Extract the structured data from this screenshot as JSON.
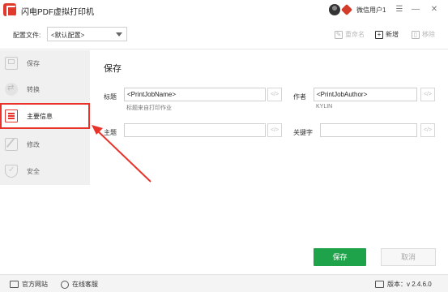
{
  "app": {
    "title": "闪电PDF虚拟打印机",
    "user_name": "微信用户1"
  },
  "toolbar": {
    "config_label": "配置文件:",
    "config_value": "<默认配置>",
    "rename_label": "重命名",
    "add_label": "新增",
    "remove_label": "移除"
  },
  "sidebar": {
    "items": [
      {
        "label": "保存",
        "icon": "save-icon",
        "active": false
      },
      {
        "label": "转换",
        "icon": "convert-icon",
        "active": false
      },
      {
        "label": "主要信息",
        "icon": "info-list-icon",
        "active": true
      },
      {
        "label": "修改",
        "icon": "edit-icon",
        "active": false
      },
      {
        "label": "安全",
        "icon": "shield-icon",
        "active": false
      }
    ]
  },
  "main": {
    "title": "保存",
    "fields": {
      "title": {
        "label": "标题",
        "value": "<PrintJobName>",
        "hint": "标题来自打印作业"
      },
      "author": {
        "label": "作者",
        "value": "<PrintJobAuthor>",
        "hint": "KYLIN"
      },
      "subject": {
        "label": "主题",
        "value": ""
      },
      "keywords": {
        "label": "关键字",
        "value": ""
      }
    },
    "code_button": "</>",
    "save_button": "保存",
    "cancel_button": "取消"
  },
  "statusbar": {
    "website": "官方网站",
    "service": "在线客服",
    "version": "版本：v 2.4.6.0"
  },
  "colors": {
    "accent_red": "#e8322a",
    "save_green": "#1fa34a",
    "sidebar_bg": "#f0f0f0"
  }
}
